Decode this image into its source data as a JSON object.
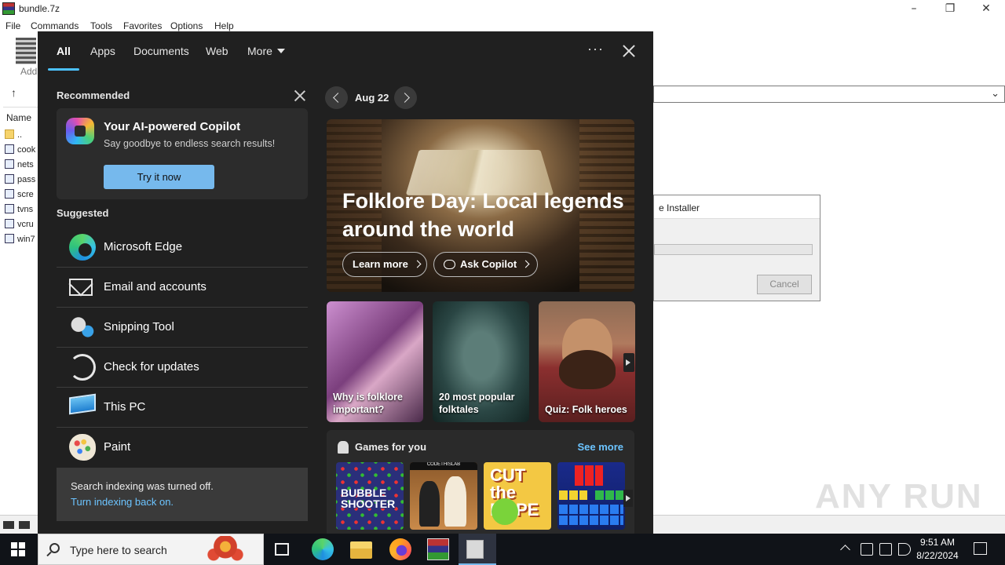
{
  "background_window": {
    "title": "bundle.7z",
    "menu": [
      "File",
      "Commands",
      "Tools",
      "Favorites",
      "Options",
      "Help"
    ],
    "toolbar_add_label": "Add",
    "list_header": "Name",
    "files": [
      "..",
      "cook",
      "nets",
      "pass",
      "scre",
      "tvns",
      "vcru",
      "win7"
    ],
    "installer_title": "e Installer",
    "installer_cancel": "Cancel",
    "watermark": "ANY RUN"
  },
  "search": {
    "tabs": [
      "All",
      "Apps",
      "Documents",
      "Web",
      "More"
    ],
    "ellipsis": "···",
    "recommended_label": "Recommended",
    "copilot": {
      "title": "Your AI-powered Copilot",
      "subtitle": "Say goodbye to endless search results!",
      "button": "Try it now"
    },
    "suggested_label": "Suggested",
    "apps": [
      {
        "label": "Microsoft Edge",
        "icon": "edge-icon"
      },
      {
        "label": "Email and accounts",
        "icon": "mail-icon"
      },
      {
        "label": "Snipping Tool",
        "icon": "snipping-tool-icon"
      },
      {
        "label": "Check for updates",
        "icon": "refresh-icon"
      },
      {
        "label": "This PC",
        "icon": "computer-icon"
      },
      {
        "label": "Paint",
        "icon": "paint-palette-icon"
      }
    ],
    "indexing": {
      "message": "Search indexing was turned off.",
      "link": "Turn indexing back on."
    },
    "highlights": {
      "date": "Aug 22",
      "hero_title": "Folklore Day: Local legends around the world",
      "learn_more": "Learn more",
      "ask_copilot": "Ask Copilot",
      "cards": [
        "Why is folklore important?",
        "20 most popular folktales",
        "Quiz: Folk heroes"
      ]
    },
    "games": {
      "title": "Games for you",
      "see_more": "See more",
      "tiles": [
        "BUBBLE SHOOTER",
        "CODETHISLAB",
        "CUT the ROPE",
        ""
      ]
    }
  },
  "taskbar": {
    "search_placeholder": "Type here to search",
    "time": "9:51 AM",
    "date": "8/22/2024"
  }
}
